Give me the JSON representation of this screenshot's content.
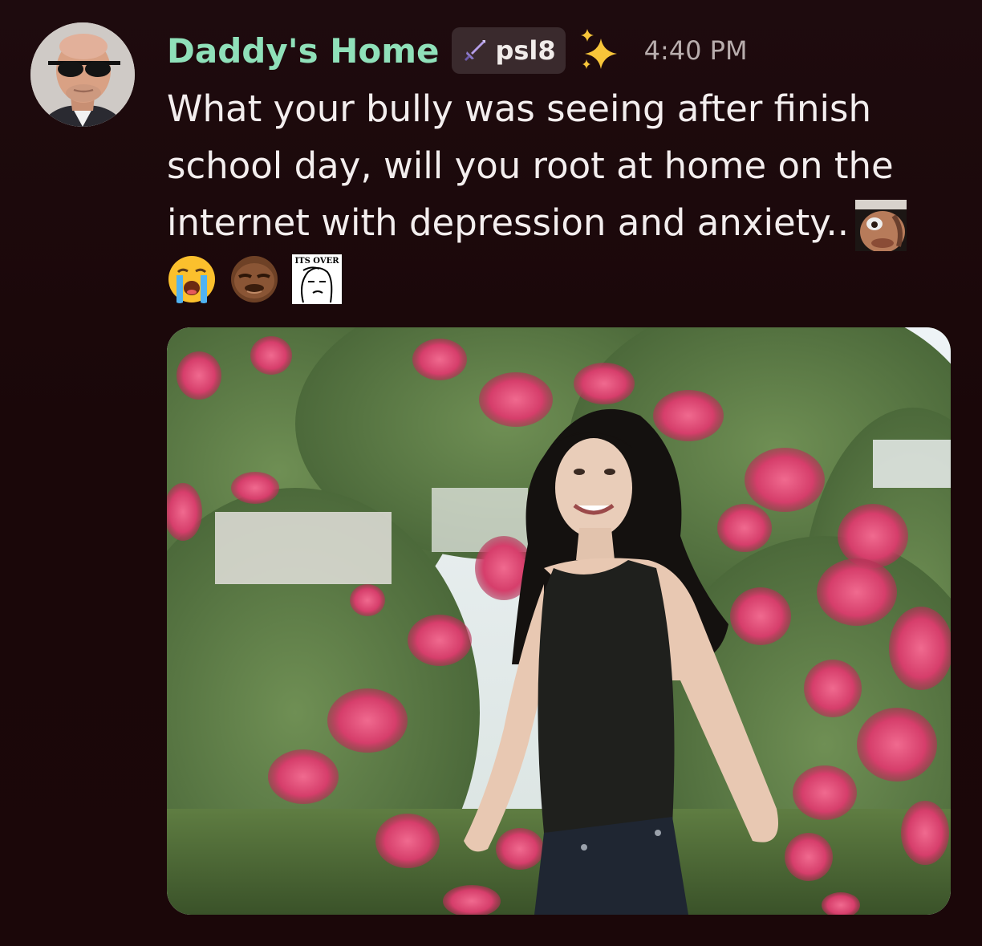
{
  "message": {
    "author": {
      "name": "Daddy's Home",
      "name_color": "#8fe0b9",
      "avatar_icon": "avatar-sunglasses-man"
    },
    "server_tag": {
      "icon": "sword-icon",
      "text": "psl8"
    },
    "decoration_icon": "sparkles-icon",
    "timestamp": "4:40 PM",
    "content_lines": [
      "What your bully was seeing after finish",
      "school day, will you root at home on the",
      "internet with depression and anxiety.."
    ],
    "inline_emoji": "custom-face-emoji",
    "emojis": [
      {
        "name": "loudly-crying-face-emoji"
      },
      {
        "name": "custom-squinting-face-emoji"
      },
      {
        "name": "its-over-wojak-emoji",
        "caption": "ITS OVER"
      }
    ],
    "attachment": {
      "type": "image",
      "subject": "photo-woman-flowers"
    }
  },
  "colors": {
    "background": "#1a0709",
    "text": "#f3eeee",
    "timestamp": "#b8adad",
    "tag_background": "#3a2a2d"
  }
}
